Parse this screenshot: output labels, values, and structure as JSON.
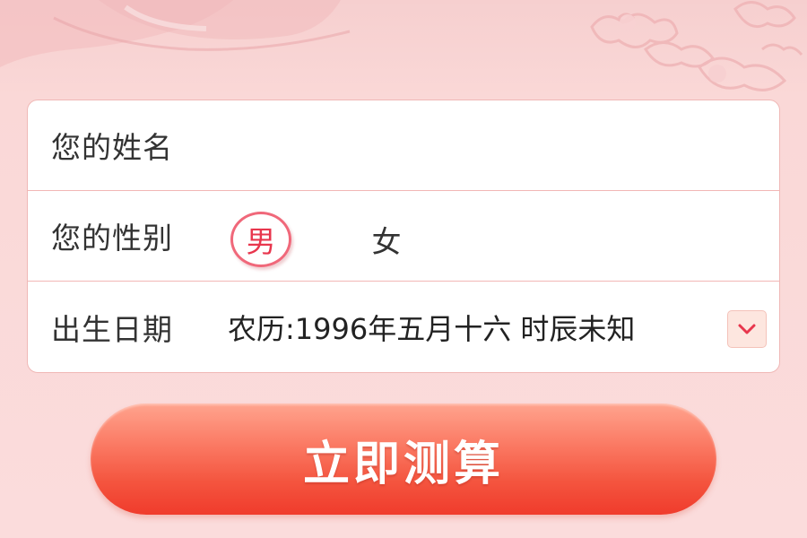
{
  "form": {
    "name": {
      "label": "您的姓名",
      "value": ""
    },
    "gender": {
      "label": "您的性别",
      "options": [
        "男",
        "女"
      ],
      "selected": "男"
    },
    "birth_date": {
      "label": "出生日期",
      "value": "农历:1996年五月十六 时辰未知"
    }
  },
  "submit": {
    "label": "立即测算"
  },
  "colors": {
    "accent": "#f03b2c",
    "selected_gender": "#e8364d",
    "background": "#fbd9d8"
  },
  "icons": {
    "dropdown": "chevron-down-icon",
    "header": "cloud-decoration"
  }
}
